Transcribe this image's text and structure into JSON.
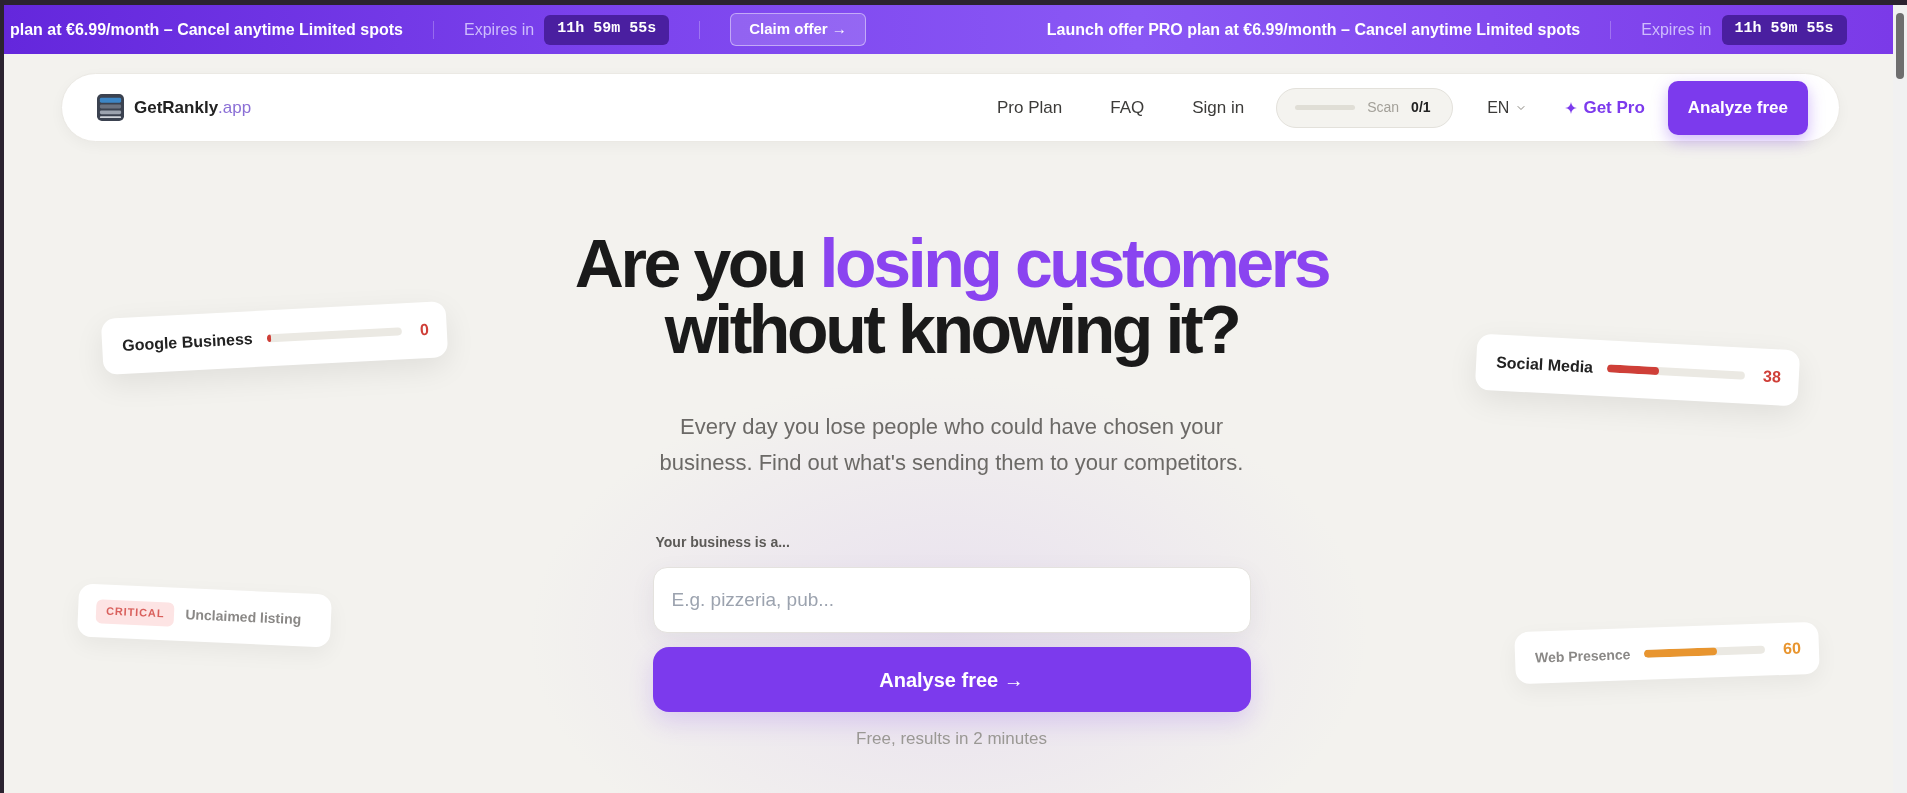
{
  "promo_banner": {
    "items": [
      {
        "kind": "promo",
        "text": "plan at €6.99/month – Cancel anytime Limited spots"
      },
      {
        "kind": "expiry",
        "label": "Expires in",
        "timer": "11h 59m 55s"
      },
      {
        "kind": "cta",
        "label": "Claim offer →"
      },
      {
        "kind": "promo",
        "text": "Launch offer PRO plan at €6.99/month – Cancel anytime Limited spots"
      },
      {
        "kind": "expiry",
        "label": "Expires in",
        "timer": "11h 59m 55s"
      }
    ]
  },
  "navbar": {
    "logo": "**GetRankly**.app",
    "links": [
      "Pro Plan",
      "FAQ",
      "Sign in"
    ],
    "scan": {
      "label": "Scan",
      "count": "0/1"
    },
    "language": "EN",
    "get_pro": "Get Pro",
    "cta": "Analyze free"
  },
  "hero": {
    "heading": {
      "before": "Are you",
      "highlight": "losing customers",
      "after": "without knowing it?"
    },
    "subtitle": "Every day you lose people who could have chosen your business. Find out what's sending them to your competitors.",
    "form": {
      "label": "Your business is a...",
      "placeholder": "E.g. pizzeria, pub...",
      "button": "Analyse free →",
      "note": "Free, results in 2 minutes"
    }
  },
  "floating_cards": [
    {
      "kind": "score",
      "label": "Google Business",
      "level": 0.03,
      "score": "0",
      "color": "#cf3f38",
      "faded": false
    },
    {
      "kind": "score",
      "label": "Social Media",
      "level": 0.38,
      "score": "38",
      "color": "#cf3f38",
      "faded": false
    },
    {
      "kind": "issue",
      "badge": "CRITICAL",
      "label": "Unclaimed listing",
      "faded": true
    },
    {
      "kind": "score",
      "label": "Web Presence",
      "level": 0.6,
      "score": "60",
      "color": "#e8952f",
      "faded": true
    }
  ]
}
